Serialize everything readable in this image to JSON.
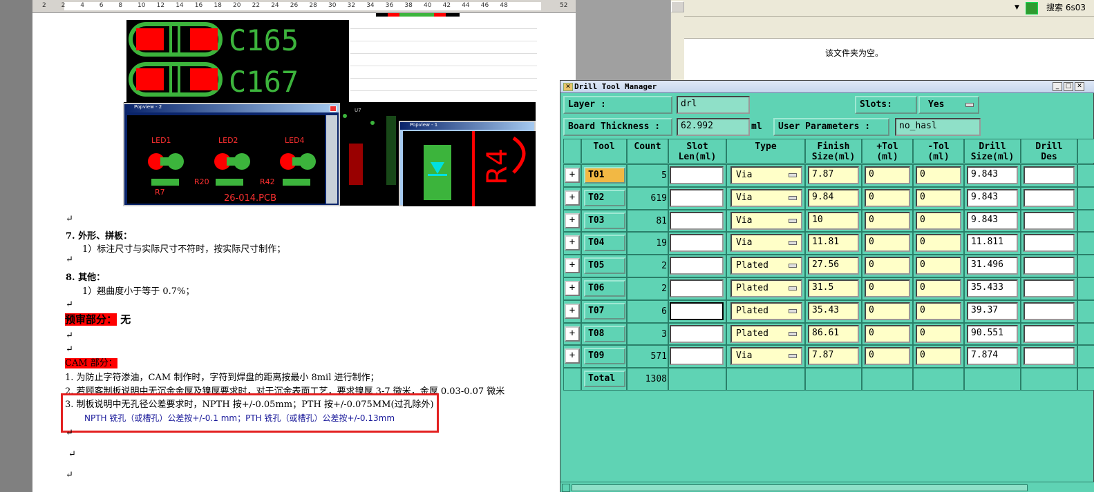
{
  "ruler": {
    "ticks": [
      "2",
      "2",
      "4",
      "6",
      "8",
      "10",
      "12",
      "14",
      "16",
      "18",
      "20",
      "22",
      "24",
      "26",
      "28",
      "30",
      "32",
      "34",
      "36",
      "38",
      "40",
      "42",
      "44",
      "46",
      "48",
      "52"
    ]
  },
  "explorer": {
    "search_label": "搜索 6s03",
    "empty_msg": "该文件夹为空。"
  },
  "doc": {
    "pcb_labels": {
      "c165": "C165",
      "c167": "C167",
      "led1": "LED1",
      "led2": "LED2",
      "led4": "LED4",
      "r7": "R7",
      "r20": "R20",
      "r42": "R42",
      "pcb": "26-014.PCB",
      "popview1": "Popview - 2",
      "popview2": "Popview - 1",
      "r4": "R4"
    },
    "s7_title": "7.  外形、拼板：",
    "s7_item": "1）标注尺寸与实际尺寸不符时，按实际尺寸制作；",
    "s8_title": "8.  其他：",
    "s8_item": "1）翘曲度小于等于 0.7%；",
    "pre_label": "预审部分：",
    "pre_value": "无",
    "cam_label": "CAM 部分：",
    "cam_1": "1.    为防止字符渗油，CAM 制作时，字符到焊盘的距离按最小 8mil 进行制作；",
    "cam_2": "2.    若顾客制板说明中无沉金金厚及镍厚要求时，对于沉金表面工艺，要求镍厚 3-7 微米，金厚 0.03-0.07 微米",
    "cam_3": "3.    制板说明中无孔径公差要求时，NPTH 按+/-0.05mm；PTH 按+/-0.075MM(过孔除外)",
    "cam_3b": "NPTH 铣孔（或槽孔）公差按+/-0.1 mm；PTH 铣孔（或槽孔）公差按+/-0.13mm",
    "para_mark": "↵"
  },
  "dtm": {
    "title": "Drill Tool Manager",
    "layer_label": "Layer            :",
    "layer_value": "drl",
    "slots_label": "Slots:",
    "slots_value": "Yes",
    "thick_label": "Board Thickness :",
    "thick_value": "62.992",
    "thick_unit": "ml",
    "user_params_label": "User Parameters :",
    "user_params_value": "no_hasl",
    "headers": [
      "Tool",
      "Count",
      "Slot\nLen(ml)",
      "Type",
      "Finish\nSize(ml)",
      "+Tol\n(ml)",
      "-Tol\n(ml)",
      "Drill\nSize(ml)",
      "Drill\nDes"
    ],
    "rows": [
      {
        "tool": "T01",
        "count": "5",
        "slot": "",
        "type": "Via",
        "finish": "7.87",
        "ptol": "0",
        "ntol": "0",
        "drill": "9.843",
        "des": ""
      },
      {
        "tool": "T02",
        "count": "619",
        "slot": "",
        "type": "Via",
        "finish": "9.84",
        "ptol": "0",
        "ntol": "0",
        "drill": "9.843",
        "des": ""
      },
      {
        "tool": "T03",
        "count": "81",
        "slot": "",
        "type": "Via",
        "finish": "10",
        "ptol": "0",
        "ntol": "0",
        "drill": "9.843",
        "des": ""
      },
      {
        "tool": "T04",
        "count": "19",
        "slot": "",
        "type": "Via",
        "finish": "11.81",
        "ptol": "0",
        "ntol": "0",
        "drill": "11.811",
        "des": ""
      },
      {
        "tool": "T05",
        "count": "2",
        "slot": "",
        "type": "Plated",
        "finish": "27.56",
        "ptol": "0",
        "ntol": "0",
        "drill": "31.496",
        "des": ""
      },
      {
        "tool": "T06",
        "count": "2",
        "slot": "",
        "type": "Plated",
        "finish": "31.5",
        "ptol": "0",
        "ntol": "0",
        "drill": "35.433",
        "des": ""
      },
      {
        "tool": "T07",
        "count": "6",
        "slot": "",
        "type": "Plated",
        "finish": "35.43",
        "ptol": "0",
        "ntol": "0",
        "drill": "39.37",
        "des": ""
      },
      {
        "tool": "T08",
        "count": "3",
        "slot": "",
        "type": "Plated",
        "finish": "86.61",
        "ptol": "0",
        "ntol": "0",
        "drill": "90.551",
        "des": ""
      },
      {
        "tool": "T09",
        "count": "571",
        "slot": "",
        "type": "Via",
        "finish": "7.87",
        "ptol": "0",
        "ntol": "0",
        "drill": "7.874",
        "des": ""
      }
    ],
    "total_label": "Total",
    "total_count": "1308"
  }
}
